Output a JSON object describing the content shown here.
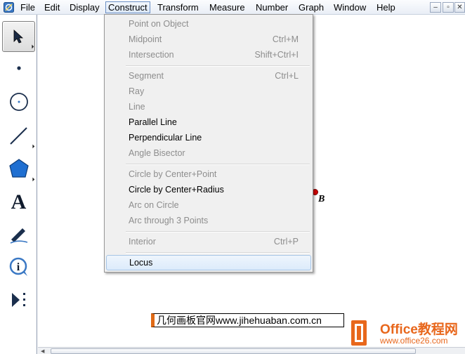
{
  "menubar": {
    "items": [
      "File",
      "Edit",
      "Display",
      "Construct",
      "Transform",
      "Measure",
      "Number",
      "Graph",
      "Window",
      "Help"
    ],
    "active": "Construct",
    "window_buttons": [
      "minimize-icon",
      "restore-icon",
      "close-icon"
    ]
  },
  "toolbox": {
    "tools": [
      "arrow-select-icon",
      "point-icon",
      "compass-circle-icon",
      "straightedge-icon",
      "polygon-icon",
      "text-icon",
      "marker-icon",
      "information-icon",
      "custom-tool-icon"
    ],
    "selected": "arrow-select-icon"
  },
  "canvas": {
    "point_label": "B",
    "point_color": "#d40000"
  },
  "construct_menu": {
    "items": [
      {
        "label": "Point on Object",
        "shortcut": "",
        "enabled": false
      },
      {
        "label": "Midpoint",
        "shortcut": "Ctrl+M",
        "enabled": false
      },
      {
        "label": "Intersection",
        "shortcut": "Shift+Ctrl+I",
        "enabled": false
      },
      {
        "label": "Segment",
        "shortcut": "Ctrl+L",
        "enabled": false
      },
      {
        "label": "Ray",
        "shortcut": "",
        "enabled": false
      },
      {
        "label": "Line",
        "shortcut": "",
        "enabled": false
      },
      {
        "label": "Parallel Line",
        "shortcut": "",
        "enabled": true
      },
      {
        "label": "Perpendicular Line",
        "shortcut": "",
        "enabled": true
      },
      {
        "label": "Angle Bisector",
        "shortcut": "",
        "enabled": false
      },
      {
        "label": "Circle by Center+Point",
        "shortcut": "",
        "enabled": false
      },
      {
        "label": "Circle by Center+Radius",
        "shortcut": "",
        "enabled": true
      },
      {
        "label": "Arc on Circle",
        "shortcut": "",
        "enabled": false
      },
      {
        "label": "Arc through 3 Points",
        "shortcut": "",
        "enabled": false
      },
      {
        "label": "Interior",
        "shortcut": "Ctrl+P",
        "enabled": false
      },
      {
        "label": "Locus",
        "shortcut": "",
        "enabled": true
      }
    ],
    "highlighted": "Locus"
  },
  "watermark": {
    "banner_text": "几何画板官网www.jihehuaban.com.cn",
    "logo_title": "Office教程网",
    "logo_url": "www.office26.com",
    "logo_color": "#e8671c"
  }
}
